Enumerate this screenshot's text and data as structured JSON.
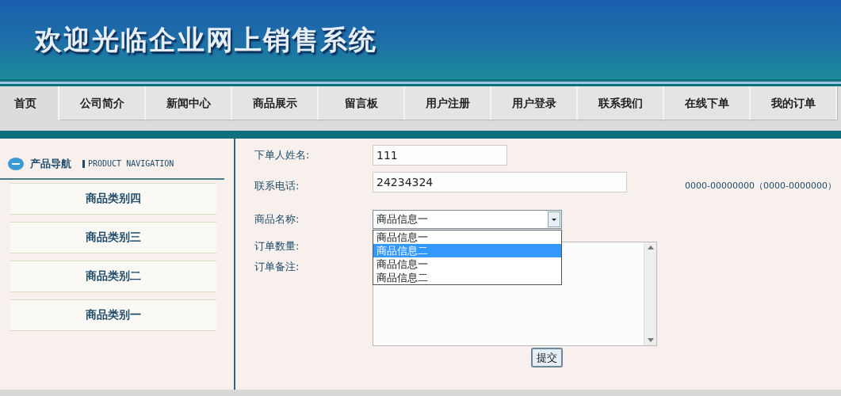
{
  "banner": {
    "title": "欢迎光临企业网上销售系统"
  },
  "nav": [
    {
      "label": "首页",
      "selected": true
    },
    {
      "label": "公司简介",
      "selected": false
    },
    {
      "label": "新闻中心",
      "selected": false
    },
    {
      "label": "商品展示",
      "selected": false
    },
    {
      "label": "留言板",
      "selected": false
    },
    {
      "label": "用户注册",
      "selected": false
    },
    {
      "label": "用户登录",
      "selected": false
    },
    {
      "label": "联系我们",
      "selected": false
    },
    {
      "label": "在线下单",
      "selected": false
    },
    {
      "label": "我的订单",
      "selected": false
    }
  ],
  "sidebar": {
    "title": "产品导航",
    "subtitle": "PRODUCT NAVIGATION",
    "items": [
      "商品类别四",
      "商品类别三",
      "商品类别二",
      "商品类别一"
    ]
  },
  "form": {
    "name_label": "下单人姓名:",
    "name_value": "111",
    "phone_label": "联系电话:",
    "phone_value": "24234324",
    "phone_hint": "0000-00000000（0000-0000000）",
    "product_label": "商品名称:",
    "product_value": "商品信息一",
    "product_options": [
      {
        "label": "商品信息一",
        "selected": false
      },
      {
        "label": "商品信息二",
        "selected": true
      },
      {
        "label": "商品信息一",
        "selected": false
      },
      {
        "label": "商品信息二",
        "selected": false
      }
    ],
    "quantity_label": "订单数量:",
    "remark_label": "订单备注:",
    "submit": "提交"
  }
}
